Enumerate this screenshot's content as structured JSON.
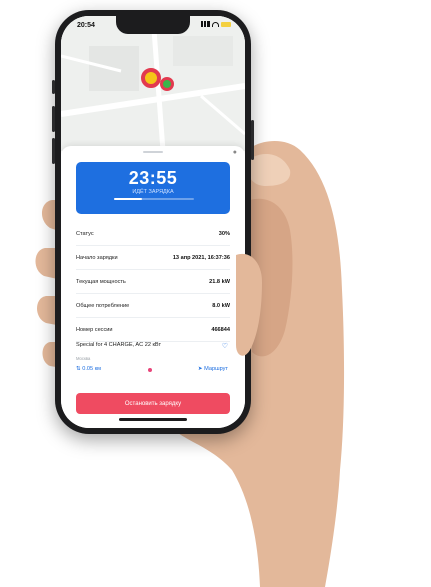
{
  "status_bar": {
    "time": "20:54"
  },
  "charging": {
    "timer": "23:55",
    "timer_label": "ИДЁТ ЗАРЯДКА",
    "progress": 0.35
  },
  "details": [
    {
      "label": "Статус",
      "value": "30%"
    },
    {
      "label": "Начало зарядки",
      "value": "13 апр 2021, 16:37:36"
    },
    {
      "label": "Текущая мощность",
      "value": "21.8 kW"
    },
    {
      "label": "Общее потребление",
      "value": "8.0 kW"
    },
    {
      "label": "Номер сессии",
      "value": "466844"
    }
  ],
  "station": {
    "name": "Special for 4 CHARGE, AC 22 кВт",
    "distance_caption": "Москва",
    "distance": "0.05 км",
    "route_label": "Маршрут"
  },
  "actions": {
    "stop_label": "Остановить зарядку"
  },
  "colors": {
    "accent": "#1e6fe0",
    "danger": "#ef4b61",
    "pin_red": "#e23a4f",
    "pin_yellow": "#f5c518",
    "pin_green": "#3bb54a"
  }
}
